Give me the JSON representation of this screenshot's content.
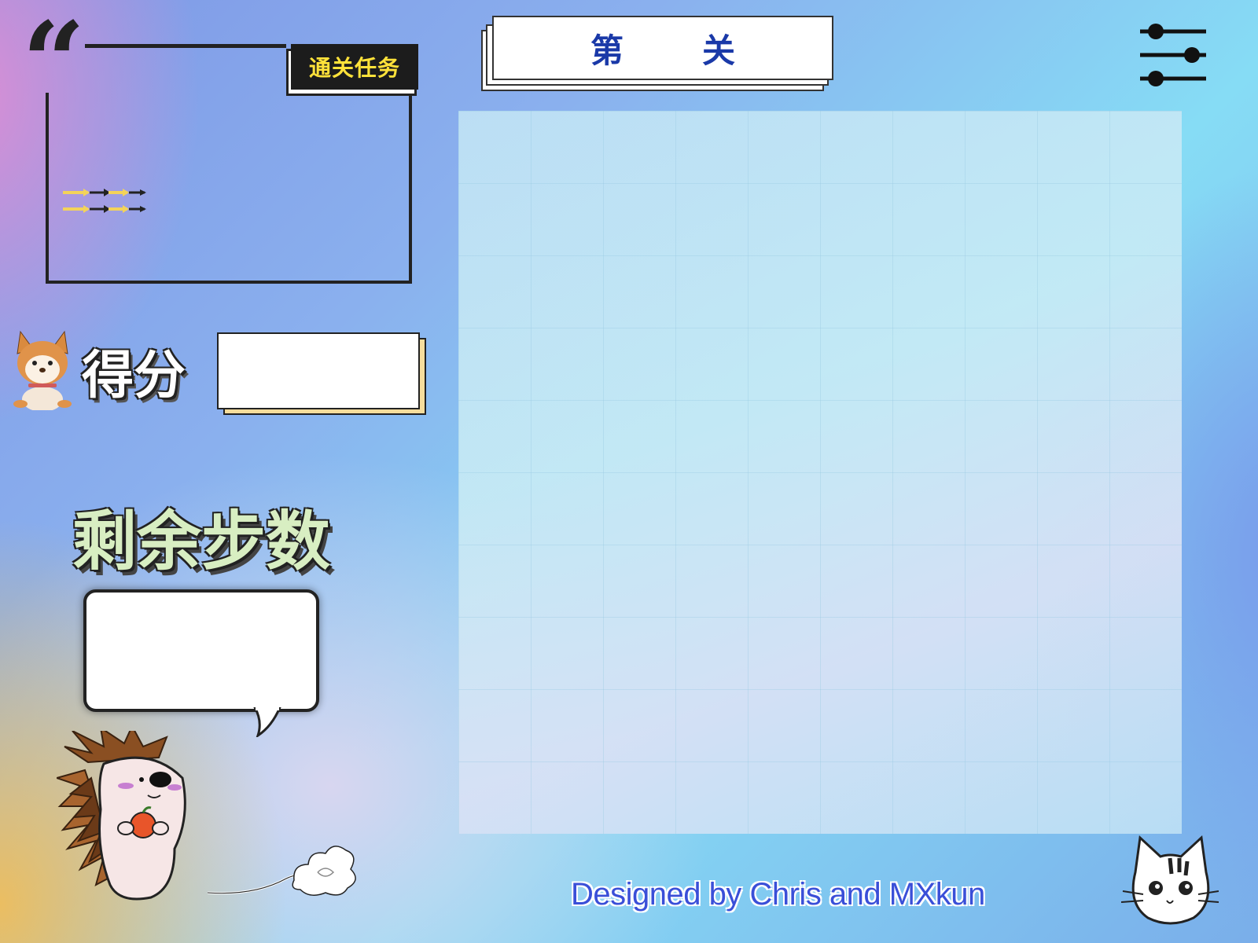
{
  "task_panel": {
    "badge_label": "通关任务",
    "arrow_icon": "double-arrow-icon"
  },
  "score": {
    "label": "得分",
    "value": ""
  },
  "steps": {
    "label": "剩余步数",
    "value": ""
  },
  "level": {
    "prefix": "第",
    "number": "",
    "suffix": "关"
  },
  "toolbar": {
    "settings_icon": "sliders-icon"
  },
  "board": {
    "rows": 10,
    "cols": 10
  },
  "footer": {
    "credit": "Designed by Chris and MXkun"
  },
  "colors": {
    "level_text": "#1a39a8",
    "badge_text": "#ffe23a",
    "credit_text": "#3a4fd8",
    "steps_label": "#d8eec2"
  }
}
